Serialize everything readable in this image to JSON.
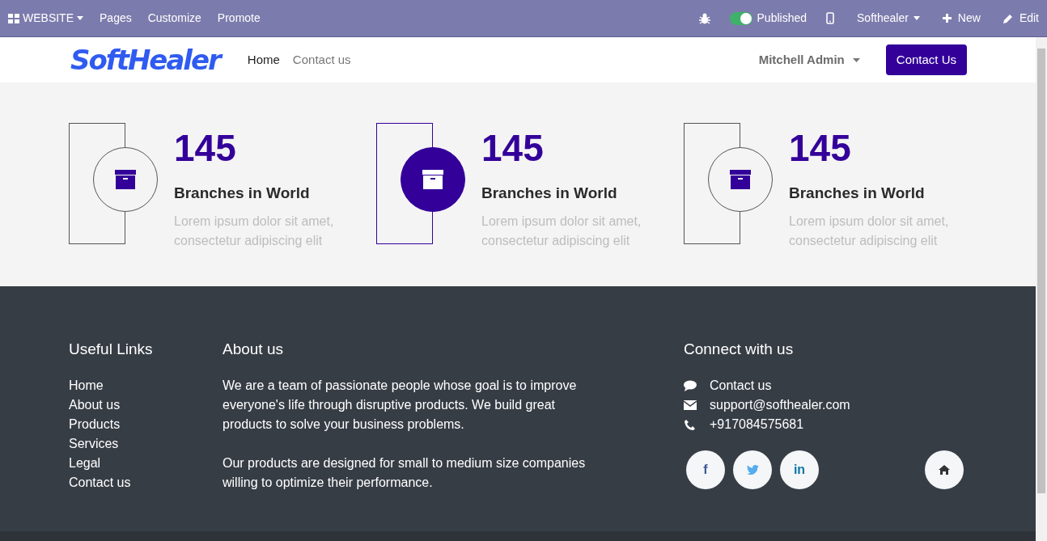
{
  "admin_bar": {
    "app_menu": "WEBSITE",
    "menu": [
      "Pages",
      "Customize",
      "Promote"
    ],
    "published": {
      "label": "Published",
      "on": true
    },
    "company": "Softhealer",
    "new": "New",
    "edit": "Edit"
  },
  "header": {
    "logo": "SoftHealer",
    "nav": [
      {
        "label": "Home",
        "selected": true
      },
      {
        "label": "Contact us",
        "selected": false
      }
    ],
    "user": "Mitchell Admin",
    "cta": "Contact Us"
  },
  "stats": [
    {
      "number": "145",
      "title": "Branches in World",
      "text": "Lorem ipsum dolor sit amet, consectetur adipiscing elit",
      "highlighted": false
    },
    {
      "number": "145",
      "title": "Branches in World",
      "text": "Lorem ipsum dolor sit amet, consectetur adipiscing elit",
      "highlighted": true
    },
    {
      "number": "145",
      "title": "Branches in World",
      "text": "Lorem ipsum dolor sit amet, consectetur adipiscing elit",
      "highlighted": false
    }
  ],
  "footer": {
    "useful_links": {
      "title": "Useful Links",
      "items": [
        "Home",
        "About us",
        "Products",
        "Services",
        "Legal",
        "Contact us"
      ]
    },
    "about": {
      "title": "About us",
      "paragraphs": [
        "We are a team of passionate people whose goal is to improve everyone's life through disruptive products. We build great products to solve your business problems.",
        "Our products are designed for small to medium size companies willing to optimize their performance."
      ]
    },
    "connect": {
      "title": "Connect with us",
      "items": [
        {
          "kind": "chat",
          "text": "Contact us"
        },
        {
          "kind": "mail",
          "text": "support@softhealer.com"
        },
        {
          "kind": "phone",
          "text": "+917084575681"
        }
      ],
      "social": [
        {
          "kind": "facebook",
          "glyph": "f"
        },
        {
          "kind": "twitter"
        },
        {
          "kind": "linkedin",
          "glyph": "in"
        }
      ]
    }
  }
}
